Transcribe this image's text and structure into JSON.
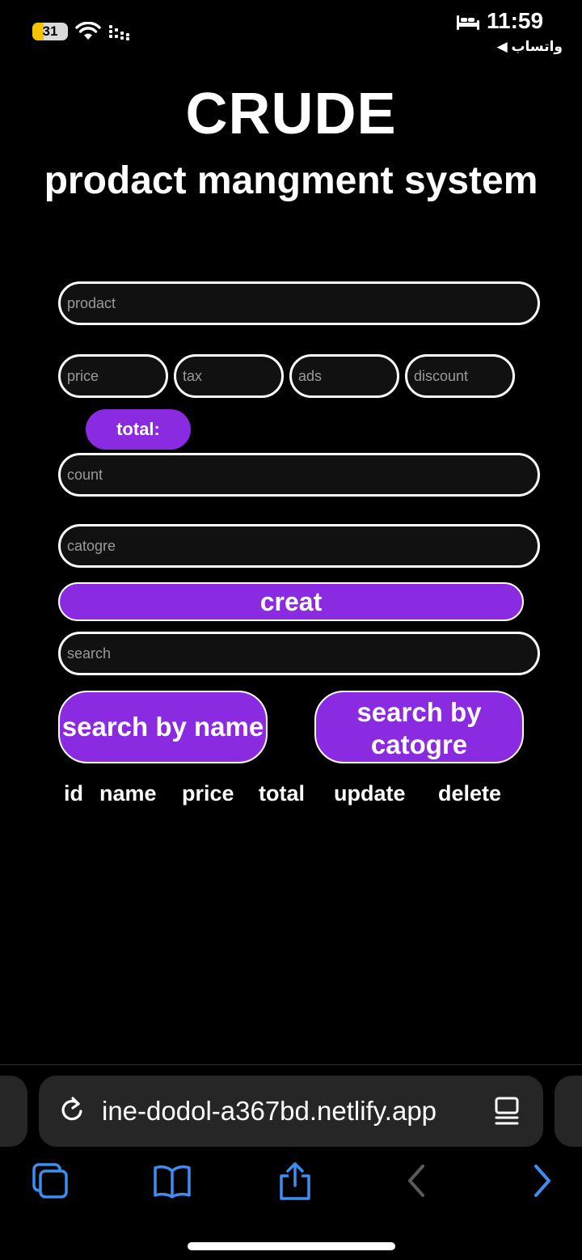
{
  "status_bar": {
    "battery": "31",
    "battery_level": 0.31,
    "time": "11:59",
    "back_app": "◀ واتساب"
  },
  "header": {
    "title": "CRUDE",
    "subtitle": "prodact mangment system"
  },
  "form": {
    "product_placeholder": "prodact",
    "price_placeholder": "price",
    "tax_placeholder": "tax",
    "ads_placeholder": "ads",
    "discount_placeholder": "discount",
    "total_label": "total:",
    "count_placeholder": "count",
    "category_placeholder": "catogre",
    "create_label": "creat",
    "search_placeholder": "search",
    "search_by_name_label": "search by name",
    "search_by_category_label": "search by catogre"
  },
  "table": {
    "headers": [
      "id",
      "name",
      "price",
      "total",
      "update",
      "delete"
    ]
  },
  "browser": {
    "url": "ine-dodol-a367bd.netlify.app",
    "accent_color": "#3d8ef0",
    "disabled_color": "#5a5a5a",
    "icons": [
      "reload-icon",
      "reader-mode-icon",
      "tabs-icon",
      "bookmarks-icon",
      "share-icon",
      "back-icon",
      "forward-icon"
    ]
  },
  "colors": {
    "button_purple": "#8a2be2",
    "background": "#000000"
  }
}
